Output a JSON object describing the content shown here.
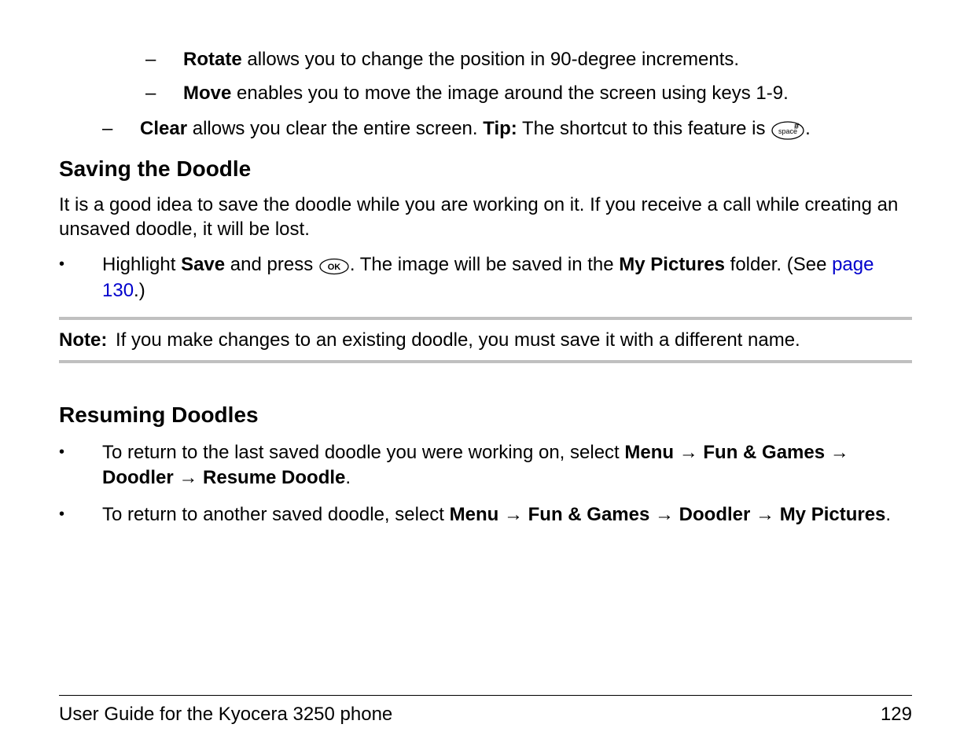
{
  "items": {
    "rotate": {
      "label": "Rotate",
      "text": " allows you to change the position in 90-degree increments."
    },
    "move": {
      "label": "Move",
      "text": " enables you to move the image around the screen using keys 1-9."
    },
    "clear": {
      "label": "Clear",
      "text_before": " allows you clear the entire screen. ",
      "tip_label": "Tip:",
      "tip_text": " The shortcut to this feature is ",
      "period": "."
    }
  },
  "section1": {
    "heading": "Saving the Doodle",
    "body": "It is a good idea to save the doodle while you are working on it. If you receive a call while creating an unsaved doodle, it will be lost.",
    "bullet": {
      "pre_save": "Highlight ",
      "save": "Save",
      "post_save": " and press ",
      "post_ok": ". The image will be saved in the ",
      "mypics": "My Pictures",
      "folder_pre": " folder. (See ",
      "page_link": "page 130",
      "folder_post": ".)"
    }
  },
  "note": {
    "label": "Note:",
    "text": "If you make changes to an existing doodle, you must save it with a different name."
  },
  "section2": {
    "heading": "Resuming Doodles",
    "bullet1": {
      "pre": "To return to the last saved doodle you were working on, select ",
      "menu": "Menu",
      "fun": "Fun & Games",
      "doodler": "Doodler",
      "resume": "Resume Doodle",
      "period": "."
    },
    "bullet2": {
      "pre": "To return to another saved doodle, select ",
      "menu": "Menu",
      "fun": "Fun & Games",
      "doodler": "Doodler",
      "mypics": "My Pictures",
      "period": "."
    }
  },
  "footer": {
    "left": "User Guide for the Kyocera 3250 phone",
    "right": "129"
  },
  "arrow": "→",
  "dash": "–",
  "bullet": "•"
}
